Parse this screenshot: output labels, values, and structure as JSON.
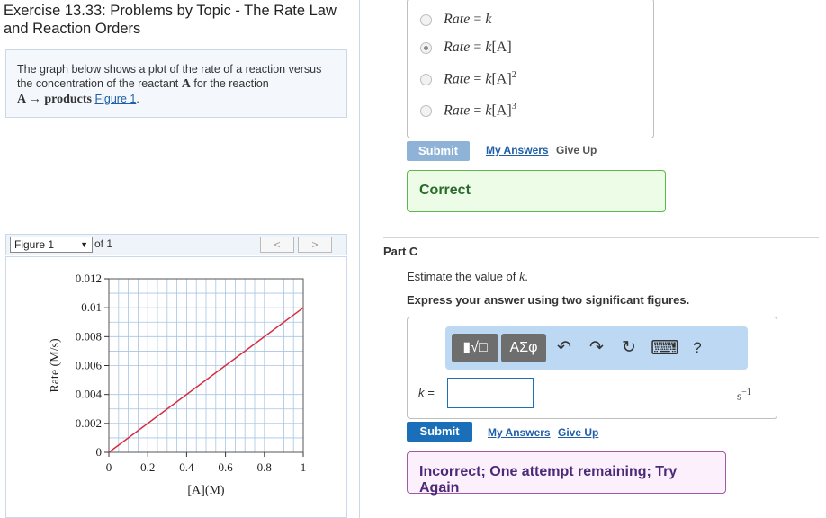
{
  "exercise_title": "Exercise 13.33: Problems by Topic - The Rate Law and Reaction Orders",
  "problem": {
    "text_a": "The graph below shows a plot of the rate of a reaction versus the concentration of the reactant ",
    "reactant": "A",
    "text_b": " for the reaction",
    "reaction": "A → products",
    "figure_link": "Figure 1",
    "text_end": "."
  },
  "figure_bar": {
    "selected": "Figure 1",
    "of_label": "of 1",
    "prev": "<",
    "next": ">"
  },
  "part_b": {
    "choices": [
      {
        "label": "Rate = k",
        "selected": false
      },
      {
        "label": "Rate = k[A]",
        "selected": true
      },
      {
        "label": "Rate = k[A]²",
        "selected": false
      },
      {
        "label": "Rate = k[A]³",
        "selected": false
      }
    ],
    "submit": "Submit",
    "my_answers": "My Answers",
    "give_up": "Give Up",
    "feedback": "Correct"
  },
  "part_c": {
    "title": "Part C",
    "prompt_a": "Estimate the value of ",
    "prompt_var": "k",
    "prompt_end": ".",
    "instruction": "Express your answer using two significant figures.",
    "toolbar": {
      "template_icon": "▮√□",
      "greek_label": "ΑΣφ",
      "undo": "↶",
      "redo": "↷",
      "reset": "↻",
      "keyboard": "⌨",
      "help": "?"
    },
    "answer_label": "k =",
    "answer_value": "",
    "unit_base": "s",
    "unit_exp": "−1",
    "submit": "Submit",
    "my_answers": "My Answers",
    "give_up": "Give Up",
    "feedback": "Incorrect; One attempt remaining; Try Again"
  },
  "colors": {
    "line": "#d62c3c",
    "grid": "#a9c4e4",
    "correct_border": "#5cb84a",
    "incorrect_border": "#a15aa5",
    "submit_active": "#1a6fb8",
    "submit_disabled": "#8fb3d6"
  },
  "chart_data": {
    "type": "line",
    "x": [
      0,
      1
    ],
    "series": [
      {
        "values": [
          0,
          0.01
        ]
      }
    ],
    "xlabel": "[A](M)",
    "ylabel": "Rate (M/s)",
    "xlim": [
      0,
      1
    ],
    "ylim": [
      0,
      0.012
    ],
    "xticks": [
      0,
      0.2,
      0.4,
      0.6,
      0.8,
      1
    ],
    "xtick_labels": [
      "0",
      "0.2",
      "0.4",
      "0.6",
      "0.8",
      "1"
    ],
    "yticks": [
      0,
      0.002,
      0.004,
      0.006,
      0.008,
      0.01,
      0.012
    ],
    "ytick_labels": [
      "0",
      "0.002",
      "0.004",
      "0.006",
      "0.008",
      "0.01",
      "0.012"
    ],
    "grid": true,
    "minor_grid_step_x": 0.05,
    "minor_grid_step_y": 0.001
  }
}
